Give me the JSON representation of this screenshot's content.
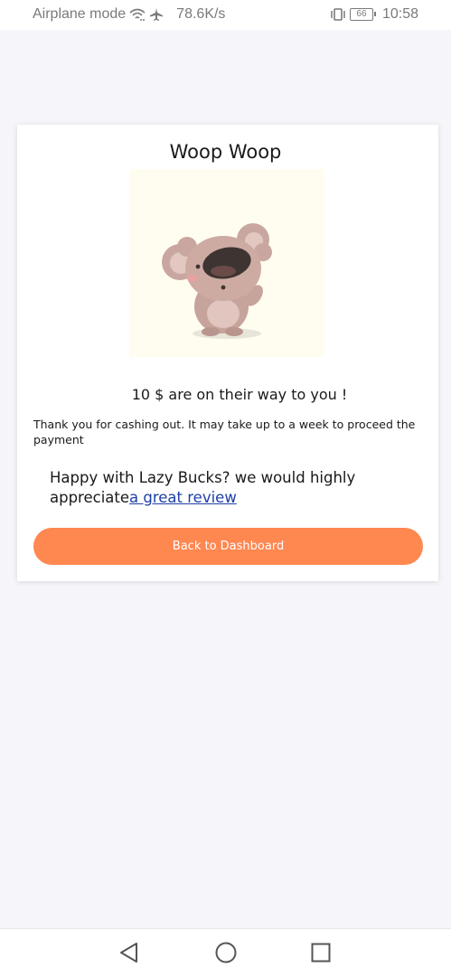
{
  "status_bar": {
    "mode": "Airplane mode",
    "speed": "78.6K/s",
    "battery": "66",
    "time": "10:58",
    "icons": [
      "wifi-icon",
      "airplane-icon",
      "vibrate-icon",
      "battery-icon"
    ]
  },
  "card": {
    "title": "Woop Woop",
    "illustration": "koala-illustration",
    "amount_message": "10 $ are on their way to you !",
    "thanks_message": "Thank you for cashing out. It may take up to a week to proceed the payment",
    "review_text": "Happy with Lazy Bucks? we would highly appreciate",
    "review_link": "a great review",
    "button_label": "Back to Dashboard"
  },
  "nav": {
    "icons": [
      "back-icon",
      "home-icon",
      "recents-icon"
    ]
  },
  "colors": {
    "accent": "#ff8750",
    "link": "#1f3fa6",
    "background": "#f6f6fa",
    "illustration_bg": "#fffdf0"
  }
}
